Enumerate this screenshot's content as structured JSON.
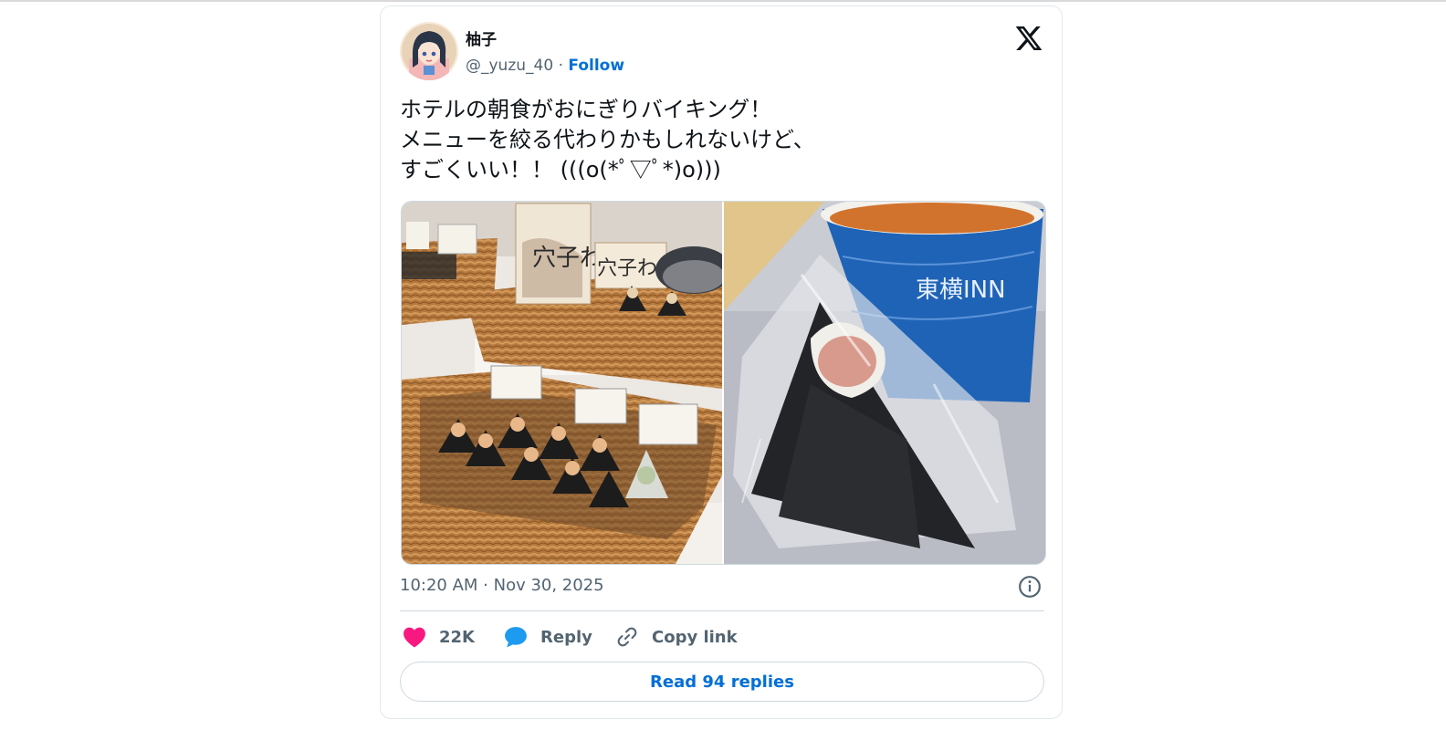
{
  "colors": {
    "link_blue": "#006fd6",
    "like_pink": "#f91880",
    "reply_blue": "#1d9bf0",
    "muted_text": "#536471",
    "border": "#cfd9de"
  },
  "author": {
    "display_name": "柚子",
    "handle": "@_yuzu_40",
    "separator": "·",
    "follow_label": "Follow",
    "avatar_icon": "anime-girl-avatar"
  },
  "brand": {
    "icon": "x-logo-icon"
  },
  "tweet": {
    "lines": [
      "ホテルの朝食がおにぎりバイキング！",
      "メニューを絞る代わりかもしれないけど、",
      "すごくいい！！ (((o(*ﾟ▽ﾟ*)o)))"
    ],
    "timestamp": "10:20 AM · Nov 30, 2025"
  },
  "media": {
    "photos": [
      {
        "subject": "onigiri-buffet-baskets",
        "card_text": "穴子わ"
      },
      {
        "subject": "onigiri-with-cup",
        "cup_text": "東横INN"
      }
    ]
  },
  "actions": {
    "like_count": "22K",
    "reply_label": "Reply",
    "copy_link_label": "Copy link",
    "read_replies_label": "Read 94 replies"
  }
}
